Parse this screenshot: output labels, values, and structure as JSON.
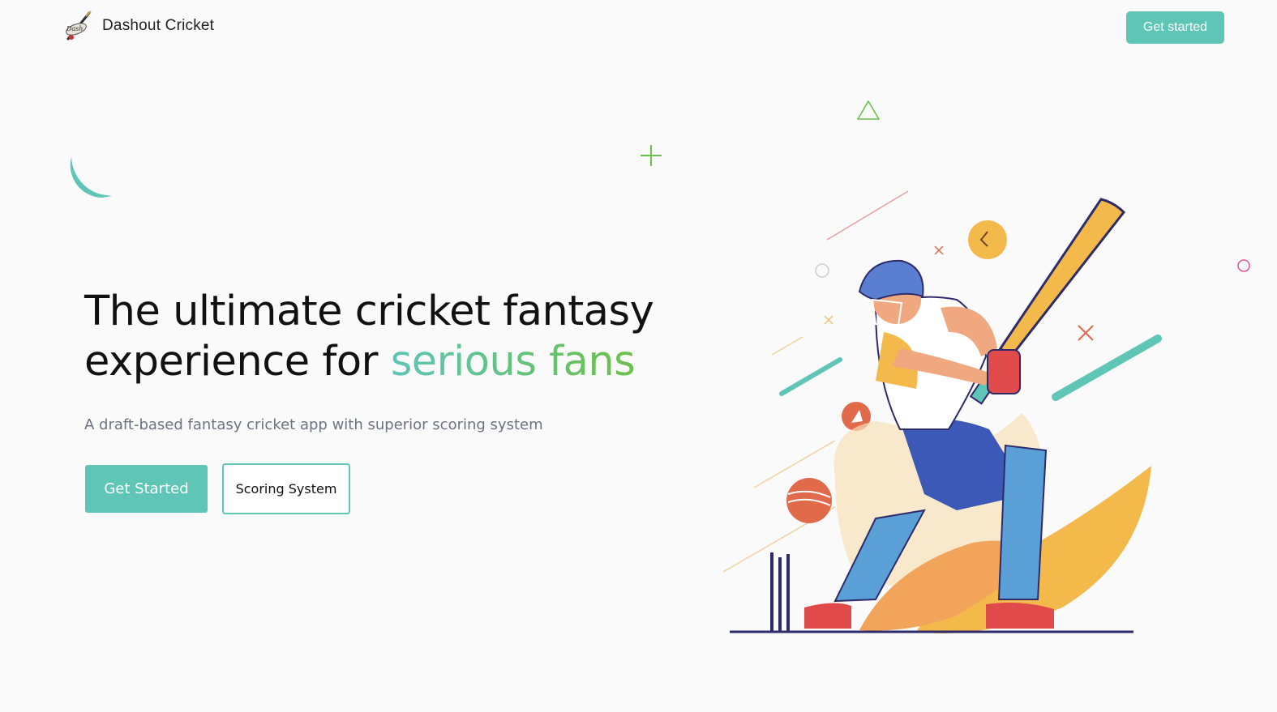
{
  "header": {
    "brand_name": "Dashout Cricket",
    "cta_label": "Get started"
  },
  "hero": {
    "title_prefix": "The ultimate cricket fantasy experience for ",
    "title_accent": "serious fans",
    "subtitle": "A draft-based fantasy cricket app with superior scoring system",
    "primary_button": "Get Started",
    "secondary_button": "Scoring System"
  },
  "illustration": {
    "icon": "cricket-batsman-illustration"
  },
  "colors": {
    "accent": "#5ec5b7",
    "accent_green": "#6cc04a",
    "background": "#fafafa",
    "subtitle": "#6b7280"
  }
}
